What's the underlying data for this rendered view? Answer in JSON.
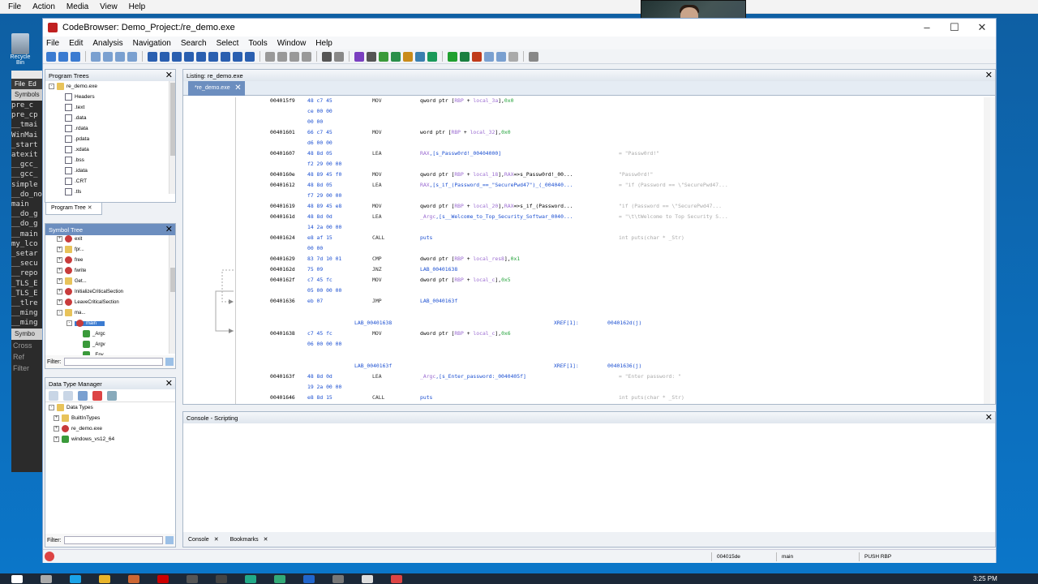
{
  "host_menu": [
    "File",
    "Action",
    "Media",
    "View",
    "Help"
  ],
  "desktop": {
    "recycle_label": "Recycle Bin"
  },
  "bg_app": {
    "menu": [
      "File",
      "Ed"
    ],
    "symbols_header": "Symbols",
    "rows": [
      "pre_c",
      "pre_cp",
      "__tmai",
      "WinMai",
      "_start",
      "atexit",
      "__gcc_",
      "__gcc_",
      "simple",
      "__do_not",
      "main",
      "__do_g",
      "__do_g",
      "__main",
      "my_lco",
      "_setar",
      "__secu",
      "__repo",
      "_TLS_E",
      "_TLS_E",
      "__tlre",
      "__ming",
      "__ming"
    ],
    "symbols2_header": "Symbo",
    "cross_ref": "Cross Ref",
    "filter": "Filter"
  },
  "window": {
    "title": "CodeBrowser: Demo_Project:/re_demo.exe"
  },
  "menu": [
    "File",
    "Edit",
    "Analysis",
    "Navigation",
    "Search",
    "Select",
    "Tools",
    "Window",
    "Help"
  ],
  "program_trees": {
    "title": "Program Trees",
    "root": "re_demo.exe",
    "items": [
      "Headers",
      ".text",
      ".data",
      ".rdata",
      ".pdata",
      ".xdata",
      ".bss",
      ".idata",
      ".CRT",
      ".tls"
    ],
    "tab": "Program Tree"
  },
  "symbol_tree": {
    "title": "Symbol Tree",
    "items": [
      "exit",
      "fpr...",
      "free",
      "fwrite",
      "Get...",
      "InitializeCriticalSection",
      "LeaveCriticalSection",
      "ma..."
    ],
    "selected": "main",
    "children": [
      "_Argc",
      "_Argv",
      "_Env"
    ],
    "filter_label": "Filter:"
  },
  "data_type_manager": {
    "title": "Data Type Manager",
    "items": [
      "Data Types",
      "BuiltInTypes",
      "re_demo.exe",
      "windows_vs12_64"
    ],
    "filter_label": "Filter:"
  },
  "listing": {
    "title": "Listing:  re_demo.exe",
    "tab": "*re_demo.exe",
    "lines": [
      {
        "addr": "004015f9",
        "bytes": "48 c7 45",
        "mn": "MOV",
        "op": [
          [
            "qword ptr [",
            "op"
          ],
          [
            "RBP",
            "var"
          ],
          [
            " + ",
            "op"
          ],
          [
            "local_3a",
            "var"
          ],
          [
            "],",
            "op"
          ],
          [
            "0x0",
            "num"
          ]
        ],
        "cmt": ""
      },
      {
        "addr": "",
        "bytes": "ce 00 00",
        "mn": "",
        "op": [],
        "cmt": ""
      },
      {
        "addr": "",
        "bytes": "00 00",
        "mn": "",
        "op": [],
        "cmt": ""
      },
      {
        "addr": "00401601",
        "bytes": "66 c7 45",
        "mn": "MOV",
        "op": [
          [
            "word ptr [",
            "op"
          ],
          [
            "RBP",
            "var"
          ],
          [
            " + ",
            "op"
          ],
          [
            "local_32",
            "var"
          ],
          [
            "],",
            "op"
          ],
          [
            "0x0",
            "num"
          ]
        ],
        "cmt": ""
      },
      {
        "addr": "",
        "bytes": "d6 00 00",
        "mn": "",
        "op": [],
        "cmt": ""
      },
      {
        "addr": "00401607",
        "bytes": "48 8d 05",
        "mn": "LEA",
        "op": [
          [
            "RAX",
            "var"
          ],
          [
            ",[s_Passw0rd!_00404000]",
            "lbl"
          ]
        ],
        "cmt": "= \"Passw0rd!\""
      },
      {
        "addr": "",
        "bytes": "f2 29 00 00",
        "mn": "",
        "op": [],
        "cmt": ""
      },
      {
        "addr": "0040160e",
        "bytes": "48 89 45 f0",
        "mn": "MOV",
        "op": [
          [
            "qword ptr [",
            "op"
          ],
          [
            "RBP",
            "var"
          ],
          [
            " + ",
            "op"
          ],
          [
            "local_18",
            "var"
          ],
          [
            "],",
            "op"
          ],
          [
            "RAX",
            "var"
          ],
          [
            "=>s_Passw0rd!_00...",
            "op"
          ]
        ],
        "cmt": "\"Passw0rd!\""
      },
      {
        "addr": "00401612",
        "bytes": "48 8d 05",
        "mn": "LEA",
        "op": [
          [
            "RAX",
            "var"
          ],
          [
            ",[s_if_(Password_==_\"SecurePwd47\")_(_004040...",
            "lbl"
          ]
        ],
        "cmt": "= \"if (Password == \\\"SecurePwd47..."
      },
      {
        "addr": "",
        "bytes": "f7 29 00 00",
        "mn": "",
        "op": [],
        "cmt": ""
      },
      {
        "addr": "00401619",
        "bytes": "48 89 45 e8",
        "mn": "MOV",
        "op": [
          [
            "qword ptr [",
            "op"
          ],
          [
            "RBP",
            "var"
          ],
          [
            " + ",
            "op"
          ],
          [
            "local_20",
            "var"
          ],
          [
            "],",
            "op"
          ],
          [
            "RAX",
            "var"
          ],
          [
            "=>s_if_(Password...",
            "op"
          ]
        ],
        "cmt": "\"if (Password == \\\"SecurePwd47..."
      },
      {
        "addr": "0040161d",
        "bytes": "48 8d 0d",
        "mn": "LEA",
        "op": [
          [
            "_Argc",
            "var"
          ],
          [
            ",[s__Welcome_to_Top_Security_Softwar_0040...",
            "lbl"
          ]
        ],
        "cmt": "= \"\\t\\tWelcome to Top Security S..."
      },
      {
        "addr": "",
        "bytes": "14 2a 00 00",
        "mn": "",
        "op": [],
        "cmt": ""
      },
      {
        "addr": "00401624",
        "bytes": "e8 af 15",
        "mn": "CALL",
        "op": [
          [
            "puts",
            "lbl"
          ]
        ],
        "cmt": "int puts(char * _Str)"
      },
      {
        "addr": "",
        "bytes": "00 00",
        "mn": "",
        "op": [],
        "cmt": ""
      },
      {
        "addr": "00401629",
        "bytes": "83 7d 10 01",
        "mn": "CMP",
        "op": [
          [
            "dword ptr [",
            "op"
          ],
          [
            "RBP",
            "var"
          ],
          [
            " + ",
            "op"
          ],
          [
            "local_res8",
            "var"
          ],
          [
            "],",
            "op"
          ],
          [
            "0x1",
            "num"
          ]
        ],
        "cmt": ""
      },
      {
        "addr": "0040162d",
        "bytes": "75 09",
        "mn": "JNZ",
        "op": [
          [
            "LAB_00401638",
            "lbl"
          ]
        ],
        "cmt": ""
      },
      {
        "addr": "0040162f",
        "bytes": "c7 45 fc",
        "mn": "MOV",
        "op": [
          [
            "dword ptr [",
            "op"
          ],
          [
            "RBP",
            "var"
          ],
          [
            " + ",
            "op"
          ],
          [
            "local_c",
            "var"
          ],
          [
            "],",
            "op"
          ],
          [
            "0x5",
            "num"
          ]
        ],
        "cmt": ""
      },
      {
        "addr": "",
        "bytes": "05 00 00 00",
        "mn": "",
        "op": [],
        "cmt": ""
      },
      {
        "addr": "00401636",
        "bytes": "eb 07",
        "mn": "JMP",
        "op": [
          [
            "LAB_0040163f",
            "lbl"
          ]
        ],
        "cmt": ""
      },
      {
        "label": "LAB_00401638",
        "xref": "XREF[1]:",
        "xref_to": "0040162d(j)"
      },
      {
        "addr": "00401638",
        "bytes": "c7 45 fc",
        "mn": "MOV",
        "op": [
          [
            "dword ptr [",
            "op"
          ],
          [
            "RBP",
            "var"
          ],
          [
            " + ",
            "op"
          ],
          [
            "local_c",
            "var"
          ],
          [
            "],",
            "op"
          ],
          [
            "0x6",
            "num"
          ]
        ],
        "cmt": ""
      },
      {
        "addr": "",
        "bytes": "06 00 00 00",
        "mn": "",
        "op": [],
        "cmt": ""
      },
      {
        "label": "LAB_0040163f",
        "xref": "XREF[1]:",
        "xref_to": "00401636(j)"
      },
      {
        "addr": "0040163f",
        "bytes": "48 8d 0d",
        "mn": "LEA",
        "op": [
          [
            "_Argc",
            "var"
          ],
          [
            ",[s_Enter_password:_0040405f]",
            "lbl"
          ]
        ],
        "cmt": "= \"Enter password: \""
      },
      {
        "addr": "",
        "bytes": "19 2a 00 00",
        "mn": "",
        "op": [],
        "cmt": ""
      },
      {
        "addr": "00401646",
        "bytes": "e8 8d 15",
        "mn": "CALL",
        "op": [
          [
            "puts",
            "lbl"
          ]
        ],
        "cmt": "int puts(char * _Str)"
      }
    ]
  },
  "console": {
    "title": "Console - Scripting",
    "tabs": [
      "Console",
      "Bookmarks"
    ]
  },
  "status": {
    "address": "004015de",
    "function": "main",
    "instruction": "PUSH RBP"
  },
  "taskbar": {
    "time": "3:25 PM"
  },
  "colors": {
    "accent": "#6c8ebf",
    "desktop": "#0b76c9"
  }
}
